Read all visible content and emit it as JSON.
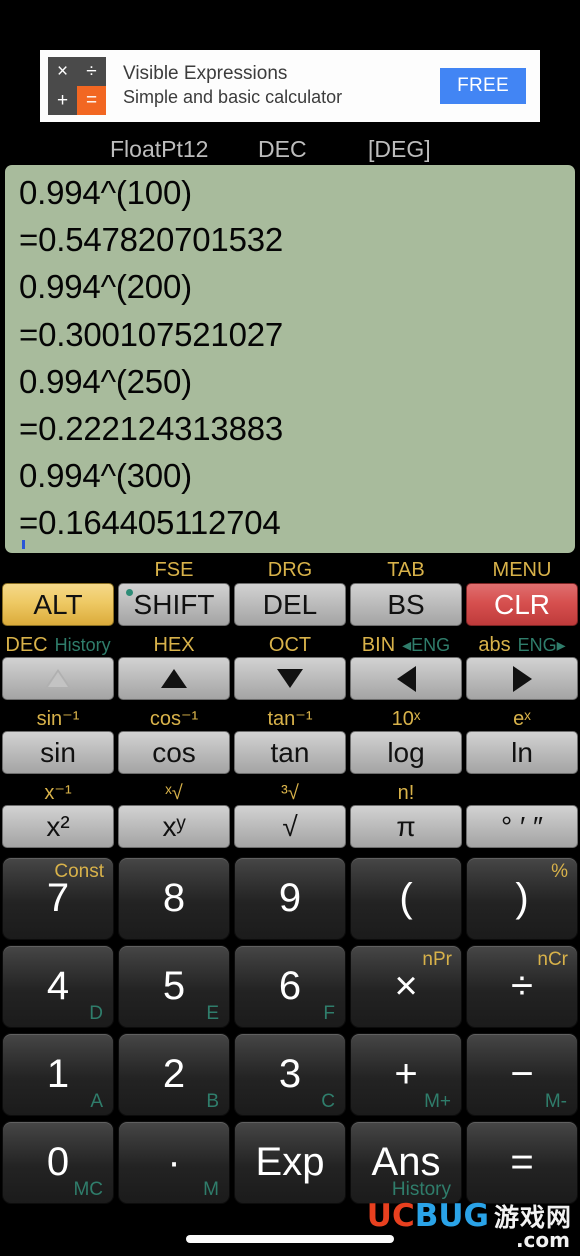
{
  "ad": {
    "title": "Visible Expressions",
    "subtitle": "Simple and basic calculator",
    "cta": "FREE",
    "icon_glyphs": [
      "×",
      "÷",
      "+",
      "="
    ]
  },
  "status": {
    "format": "FloatPt12",
    "base": "DEC",
    "angle": "[DEG]"
  },
  "display": {
    "lines": [
      "0.994^(100)",
      "=0.547820701532",
      "0.994^(200)",
      "=0.300107521027",
      "0.994^(250)",
      "=0.222124313883",
      "0.994^(300)",
      "=0.164405112704"
    ]
  },
  "keypad": {
    "row1_labels": [
      "",
      "FSE",
      "DRG",
      "TAB",
      "MENU"
    ],
    "row1": [
      "ALT",
      "SHIFT",
      "DEL",
      "BS",
      "CLR"
    ],
    "row2_labels_gold": [
      "DEC",
      "HEX",
      "OCT",
      "BIN",
      "abs"
    ],
    "row2_labels_teal": [
      "History",
      "",
      "",
      "◂ENG",
      "ENG▸"
    ],
    "row2": [
      "up-hollow",
      "up-filled",
      "down",
      "left",
      "right"
    ],
    "row3_labels": [
      "sin⁻¹",
      "cos⁻¹",
      "tan⁻¹",
      "10ˣ",
      "eˣ"
    ],
    "row3": [
      "sin",
      "cos",
      "tan",
      "log",
      "ln"
    ],
    "row4_labels": [
      "x⁻¹",
      "ˣ√",
      "³√",
      "n!",
      ""
    ],
    "row4": [
      "x²",
      "xʸ",
      "√",
      "π",
      "° ′ ″"
    ],
    "row5": [
      "7",
      "8",
      "9",
      "(",
      ")"
    ],
    "row5_gold": [
      "Const",
      "",
      "",
      "",
      "%"
    ],
    "row6": [
      "4",
      "5",
      "6",
      "×",
      "÷"
    ],
    "row6_gold": [
      "",
      "",
      "",
      "nPr",
      "nCr"
    ],
    "row6_teal": [
      "D",
      "E",
      "F",
      "",
      ""
    ],
    "row7": [
      "1",
      "2",
      "3",
      "+",
      "−"
    ],
    "row7_teal": [
      "A",
      "B",
      "C",
      "M+",
      "M-"
    ],
    "row8": [
      "0",
      "·",
      "Exp",
      "Ans",
      "="
    ],
    "row8_teal": [
      "MC",
      "M",
      "",
      "History",
      ""
    ]
  },
  "watermark": {
    "uc": "UC",
    "bug": "BUG",
    "cn": "游戏网",
    "com": ".com"
  },
  "colors": {
    "display_bg": "#a8bb9c",
    "gold": "#d8b24a",
    "teal": "#2f7d6b",
    "alt": "#eec964",
    "clr": "#d6504f",
    "ad_accent": "#f26722",
    "cta_blue": "#4285f4"
  }
}
